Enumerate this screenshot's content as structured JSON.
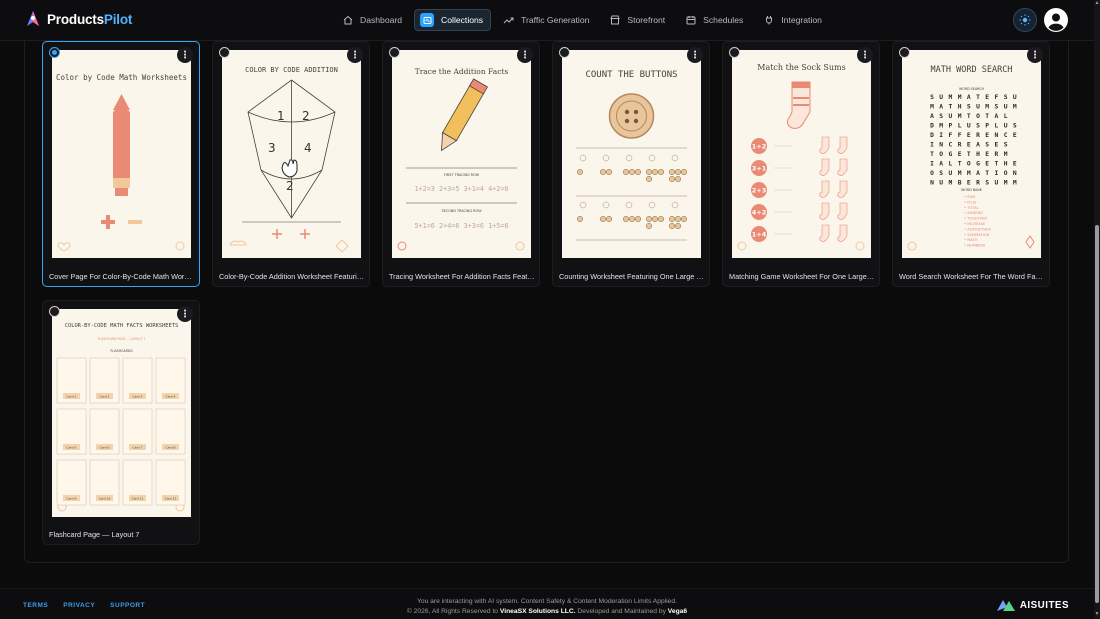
{
  "app": {
    "name_prefix": "Products",
    "name_accent": "Pilot"
  },
  "nav": {
    "items": [
      {
        "label": "Dashboard",
        "icon": "home-icon"
      },
      {
        "label": "Collections",
        "icon": "collections-icon",
        "active": true
      },
      {
        "label": "Traffic Generation",
        "icon": "trend-icon"
      },
      {
        "label": "Storefront",
        "icon": "store-icon"
      },
      {
        "label": "Schedules",
        "icon": "calendar-icon"
      },
      {
        "label": "Integration",
        "icon": "plug-icon"
      }
    ]
  },
  "cards": [
    {
      "caption": "Cover Page For Color-By-Code Math Worksheets",
      "selected": true,
      "thumb": {
        "title": "Color by Code Math Worksheets"
      }
    },
    {
      "caption": "Color-By-Code Addition Worksheet Featuring A Kite",
      "selected": false,
      "thumb": {
        "title": "COLOR BY CODE ADDITION",
        "numbers": [
          "1",
          "2",
          "3",
          "4",
          "2"
        ]
      }
    },
    {
      "caption": "Tracing Worksheet For Addition Facts Featuring A Pencil",
      "selected": false,
      "thumb": {
        "title": "Trace the Addition Facts",
        "row1_label": "FIRST TRACING ROW",
        "row1": "1+2=3  2+3=5  3+1=4  4+2=6",
        "row2_label": "SECOND TRACING ROW",
        "row2": "5+1=6  2+4=6  3+3=6  1+5=6"
      }
    },
    {
      "caption": "Counting Worksheet Featuring One Large Button",
      "selected": false,
      "thumb": {
        "title": "COUNT THE BUTTONS"
      }
    },
    {
      "caption": "Matching Game Worksheet For One Large Sock",
      "selected": false,
      "thumb": {
        "title": "Match the Sock Sums",
        "sums": [
          "1+2",
          "3+1",
          "2+3",
          "4+2",
          "1+4"
        ]
      }
    },
    {
      "caption": "Word Search Worksheet For The Word Family",
      "selected": false,
      "thumb": {
        "title": "MATH WORD SEARCH",
        "grid_label": "WORD SEARCH",
        "grid": [
          "SUMMATEFSU",
          "MATHSUMSUM",
          "ASUMTOTAL",
          "DMPLUSPLUSM",
          "DIFFERENCE",
          "INCREASES",
          "TOGETHERM",
          "IALTOGETHER",
          "OSUMMATION",
          "NUMBERSUMM"
        ],
        "bank_label": "WORD BANK",
        "bank": [
          "SUM",
          "PLUS",
          "TOTAL",
          "ADDEND",
          "TOGETHER",
          "INCREASE",
          "ALTOGETHER",
          "SUMMATION",
          "MATH",
          "NUMBERS"
        ]
      }
    },
    {
      "caption": "Flashcard Page — Layout 7",
      "selected": false,
      "thumb": {
        "title": "COLOR-BY-CODE MATH FACTS WORKSHEETS",
        "subtitle": "FLASHCARD PAGE — LAYOUT 7",
        "section": "FLASHCARDS",
        "cards": [
          "Card 1",
          "Card 2",
          "Card 3",
          "Card 4",
          "Card 5",
          "Card 6",
          "Card 7",
          "Card 8",
          "Card 9",
          "Card 10",
          "Card 11",
          "Card 12"
        ]
      }
    }
  ],
  "footer": {
    "links": [
      "TERMS",
      "PRIVACY",
      "SUPPORT"
    ],
    "notice": "You are interacting with AI system. Content Safety & Content Moderation Limits Applied.",
    "copyright_prefix": "© 2026, All Rights Reserved to ",
    "company": "VineaSX Solutions LLC.",
    "maintained_prefix": " Developed and Maintained by ",
    "maintainer": "Vega6",
    "brand": "AISUITES"
  },
  "colors": {
    "accent": "#3aa5f5",
    "coral": "#e8836a",
    "paper": "#faf6ec"
  }
}
